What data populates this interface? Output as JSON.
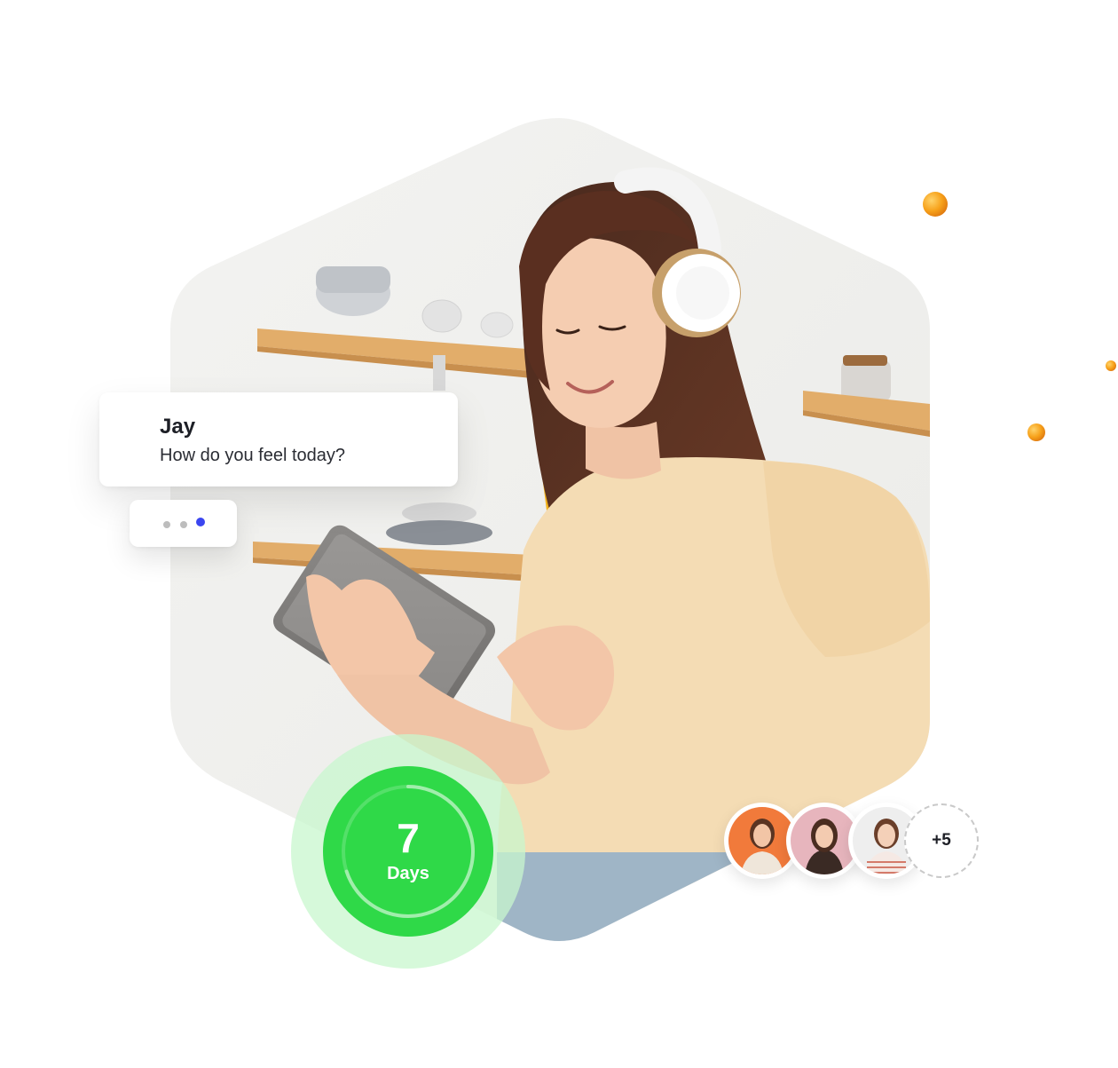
{
  "chat": {
    "name": "Jay",
    "message": "How do you feel today?"
  },
  "typing_indicator": {
    "dot_colors": [
      "#bdbdbd",
      "#bdbdbd",
      "#3b46f0"
    ]
  },
  "streak": {
    "number": "7",
    "label": "Days",
    "progress": 0.7,
    "colors": {
      "core": "#2fd948",
      "halo": "#c8f7cd"
    }
  },
  "community": {
    "more_label": "+5",
    "avatar_backgrounds": [
      "#f17a3b",
      "#e7b5bd",
      "#eeeeee"
    ]
  },
  "hero": {
    "photo_subject": "woman-with-headphones-using-tablet"
  },
  "decorations": {
    "accent_color": "#f7a21b"
  }
}
